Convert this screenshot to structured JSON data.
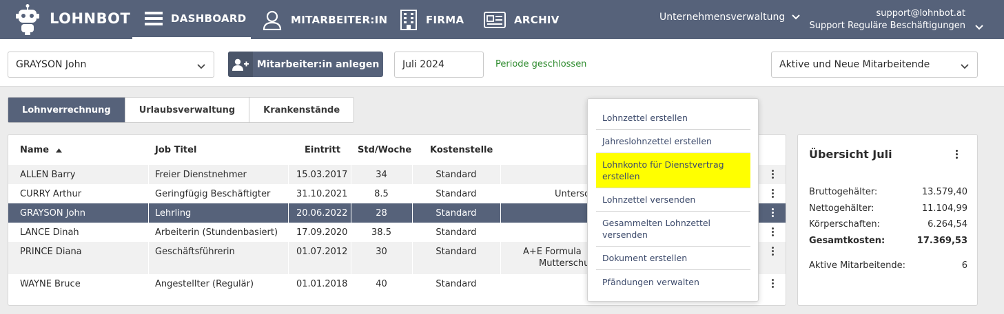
{
  "brand": "LOHNBOT",
  "nav": {
    "dashboard": "DASHBOARD",
    "employees": "MITARBEITER:IN",
    "company": "FIRMA",
    "archive": "ARCHIV"
  },
  "company_select": "Unternehmensverwaltung",
  "account": {
    "email": "support@lohnbot.at",
    "name": "Support Reguläre Beschäftigungen"
  },
  "toolbar": {
    "employee_select": "GRAYSON John",
    "add_employee": "Mitarbeiter:in anlegen",
    "period": "Juli 2024",
    "period_status": "Periode geschlossen",
    "filter": "Aktive und Neue Mitarbeitende"
  },
  "tabs": [
    "Lohnverrechnung",
    "Urlaubsverwaltung",
    "Krankenstände"
  ],
  "table": {
    "headers": {
      "name": "Name",
      "job": "Job Titel",
      "start": "Eintritt",
      "hours": "Std/Woche",
      "cost": "Kostenstelle"
    },
    "rows": [
      {
        "name": "ALLEN Barry",
        "job": "Freier Dienstnehmer",
        "start": "15.03.2017",
        "hours": "34",
        "cost": "Standard",
        "extra1": "",
        "extra2": ""
      },
      {
        "name": "CURRY Arthur",
        "job": "Geringfügig Beschäftigter",
        "start": "31.10.2021",
        "hours": "8.5",
        "cost": "Standard",
        "extra1": "Untersc",
        "extra2": ""
      },
      {
        "name": "GRAYSON John",
        "job": "Lehrling",
        "start": "20.06.2022",
        "hours": "28",
        "cost": "Standard",
        "extra1": "",
        "extra2": ""
      },
      {
        "name": "LANCE Dinah",
        "job": "Arbeiterin (Stundenbasiert)",
        "start": "17.09.2020",
        "hours": "38.5",
        "cost": "Standard",
        "extra1": "",
        "extra2": ""
      },
      {
        "name": "PRINCE Diana",
        "job": "Geschäftsführerin",
        "start": "01.07.2012",
        "hours": "30",
        "cost": "Standard",
        "extra1": "A+E Formula",
        "extra2": "Mutterschu"
      },
      {
        "name": "WAYNE Bruce",
        "job": "Angestellter (Regulär)",
        "start": "01.01.2018",
        "hours": "40",
        "cost": "Standard",
        "extra1": "",
        "extra2": ""
      }
    ]
  },
  "menu": [
    "Lohnzettel erstellen",
    "Jahreslohnzettel erstellen",
    "Lohnkonto für Dienstvertrag erstellen",
    "Lohnzettel versenden",
    "Gesammelten Lohnzettel versenden",
    "Dokument erstellen",
    "Pfändungen verwalten"
  ],
  "summary": {
    "title": "Übersicht Juli",
    "gross_label": "Bruttogehälter:",
    "gross_value": "13.579,40",
    "net_label": "Nettogehälter:",
    "net_value": "11.104,99",
    "corp_label": "Körperschaften:",
    "corp_value": "6.264,54",
    "total_label": "Gesamtkosten:",
    "total_value": "17.369,53",
    "active_label": "Aktive Mitarbeitende:",
    "active_value": "6"
  },
  "colors": {
    "nav_bg": "#56627a",
    "highlight": "#ffff00",
    "status_green": "#2e8b2e"
  }
}
